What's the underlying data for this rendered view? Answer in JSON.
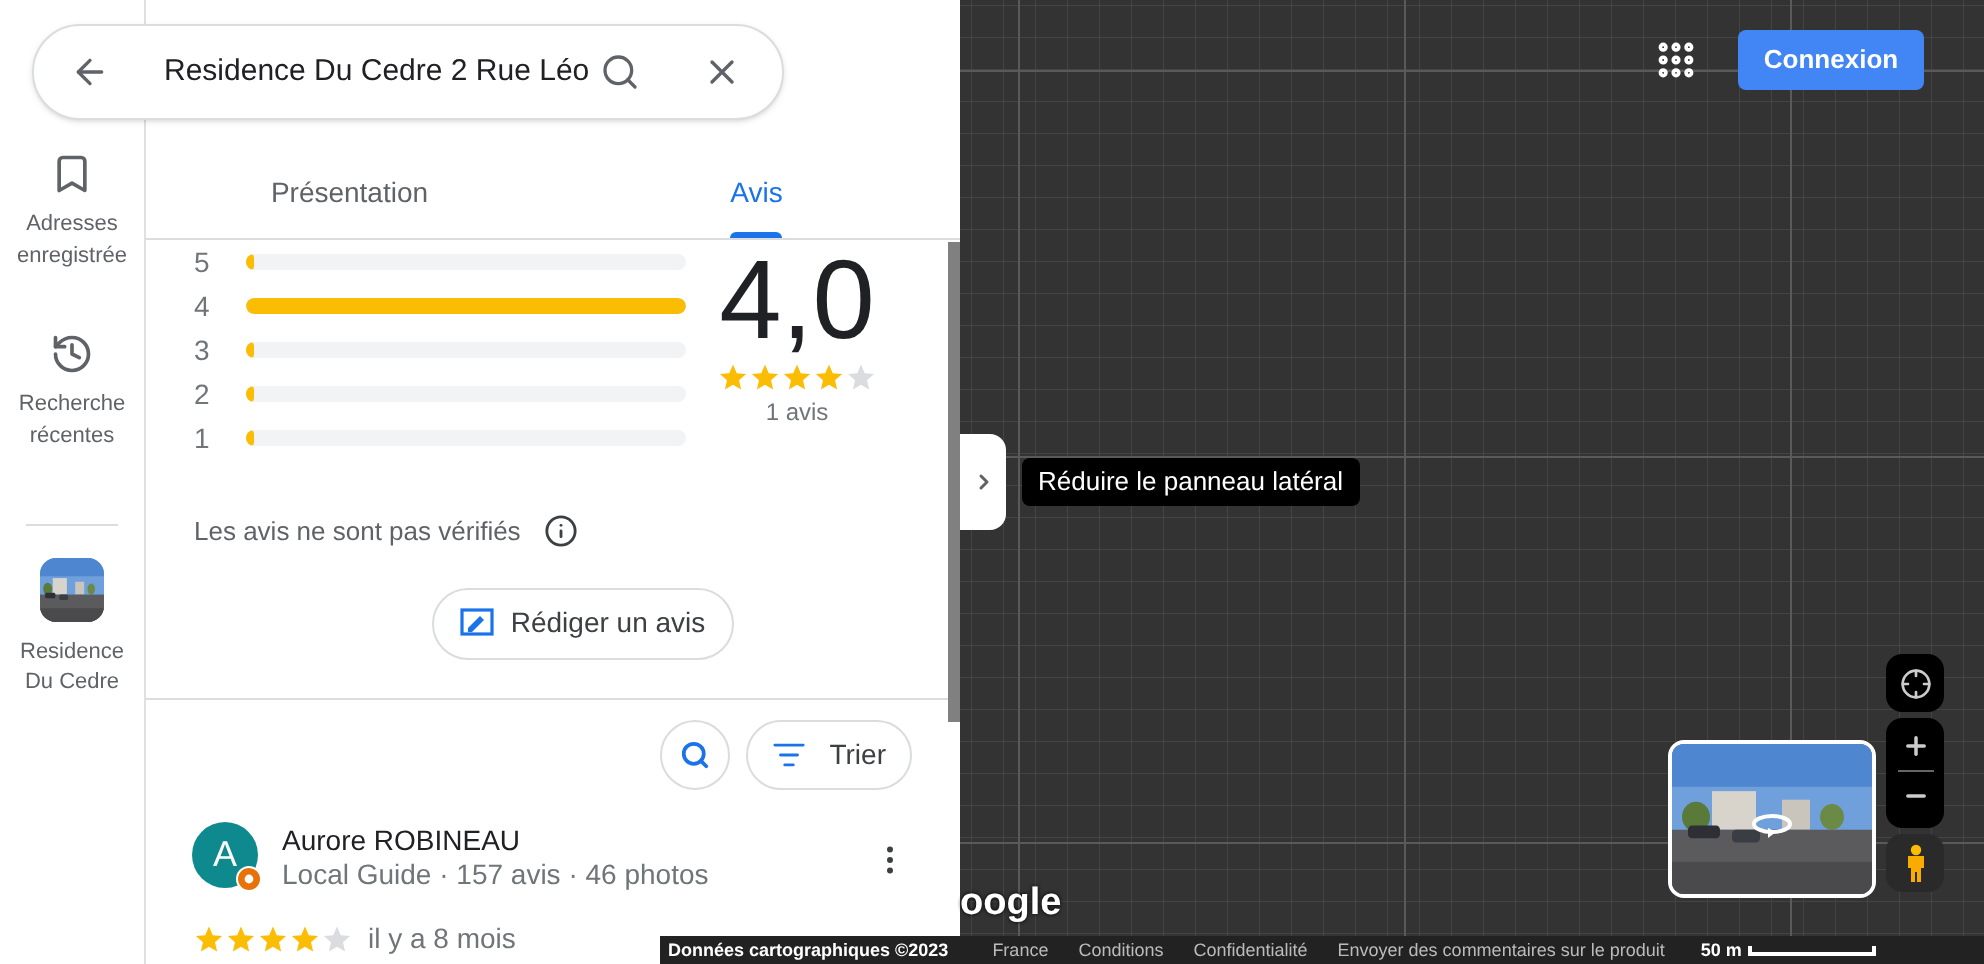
{
  "search": {
    "value": "Residence Du Cedre 2 Rue Léo"
  },
  "rail": [
    {
      "kind": "saved",
      "label": "Adresses enregistrée"
    },
    {
      "kind": "history",
      "label": "Recherche récentes"
    },
    {
      "kind": "place",
      "label": "Residence Du Cedre"
    }
  ],
  "tabs": [
    {
      "label": "Présentation",
      "selected": false
    },
    {
      "label": "Avis",
      "selected": true
    }
  ],
  "rating_bars": [
    {
      "label": "5",
      "level": 0.02
    },
    {
      "label": "4",
      "level": 1
    },
    {
      "label": "3",
      "level": 0.02
    },
    {
      "label": "2",
      "level": 0.02
    },
    {
      "label": "1",
      "level": 0.02
    }
  ],
  "rating": {
    "score": "4,0",
    "stars": 4,
    "count": "1 avis"
  },
  "notice": "Les avis ne sont pas vérifiés",
  "write_review": "Rédiger un avis",
  "sort": "Trier",
  "review": {
    "initial": "A",
    "name": "Aurore ROBINEAU",
    "meta": "Local Guide · 157 avis · 46 photos",
    "stars": 4,
    "time": "il y a 8 mois"
  },
  "map": {
    "tooltip": "Réduire le panneau latéral",
    "login": "Connexion",
    "logo": "oogle",
    "scale": "50 m"
  },
  "footer": [
    "Données cartographiques ©2023",
    "France",
    "Conditions",
    "Confidentialité",
    "Envoyer des commentaires sur le produit"
  ]
}
